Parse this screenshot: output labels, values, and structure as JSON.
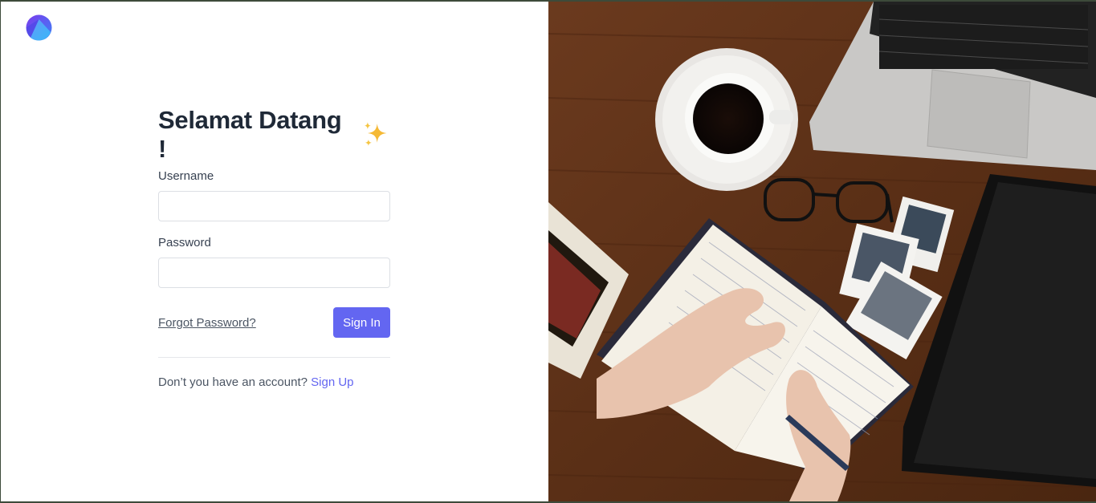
{
  "brand": {
    "logo_icon": "app-logo-icon",
    "accent": "#6366f1"
  },
  "login": {
    "title": "Selamat Datang !",
    "title_icon": "sparkles-icon",
    "username_label": "Username",
    "username_value": "",
    "username_placeholder": "",
    "password_label": "Password",
    "password_value": "",
    "password_placeholder": "",
    "forgot_label": "Forgot Password?",
    "signin_label": "Sign In",
    "no_account_text": "Don’t you have an account?",
    "signup_label": "Sign Up"
  },
  "hero": {
    "image": "desk-photo-notebook-coffee-laptop-tablet"
  }
}
